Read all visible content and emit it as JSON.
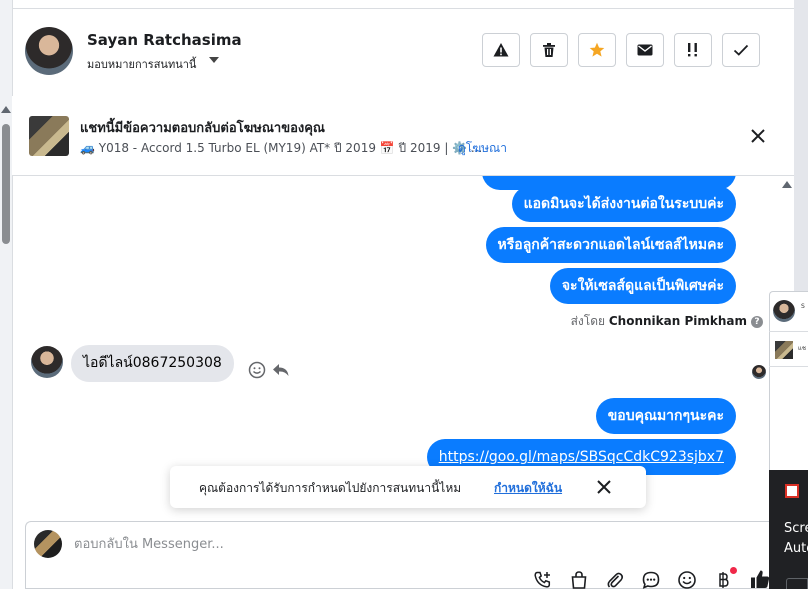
{
  "header": {
    "contact_name": "Sayan Ratchasima",
    "assign_label": "มอบหมายการสนทนานี้",
    "actions": [
      {
        "name": "report",
        "icon": "warning-icon"
      },
      {
        "name": "delete",
        "icon": "trash-icon"
      },
      {
        "name": "star",
        "icon": "star-icon",
        "color": "#f5a623"
      },
      {
        "name": "mark-unread",
        "icon": "envelope-icon"
      },
      {
        "name": "follow-up",
        "icon": "double-exclamation-icon"
      },
      {
        "name": "mark-done",
        "icon": "checkmark-icon"
      }
    ]
  },
  "ad_banner": {
    "title": "แชทนี้มีข้อความตอบกลับต่อโฆษณาของคุณ",
    "subtitle": "🚙 Y018 - Accord 1.5 Turbo EL (MY19) AT* ปี 2019 📅 ปี 2019 | ⚙️ ...",
    "link": "ดูโฆษณา"
  },
  "messages": {
    "outgoing_top": [
      "แอดมินจะได้ส่งงานต่อในระบบค่ะ",
      "หรือลูกค้าสะดวกแอดไลน์เซลส์ไหมคะ",
      "จะให้เซลส์ดูแลเป็นพิเศษค่ะ"
    ],
    "sent_by_prefix": "ส่งโดย",
    "sent_by_name": "Chonnikan Pimkham",
    "incoming": "ไอดีไลน์0867250308",
    "outgoing_bottom": [
      "ขอบคุณมากๆนะคะ",
      "https://goo.gl/maps/SBSqcCdkC923sjbx7"
    ]
  },
  "toast": {
    "text": "คุณต้องการได้รับการกำหนดไปยังการสนทนานี้ไหม",
    "link": "กำหนดให้ฉัน"
  },
  "composer": {
    "placeholder": "ตอบกลับใน Messenger..."
  },
  "overlay": {
    "name_fragment": "S",
    "title_fragment": "แช",
    "dark_line1": "Scre",
    "dark_line2": "Auto"
  },
  "colors": {
    "accent": "#0a7cff",
    "link": "#216fdb",
    "star": "#f5a623",
    "notification_dot": "#f02849"
  }
}
